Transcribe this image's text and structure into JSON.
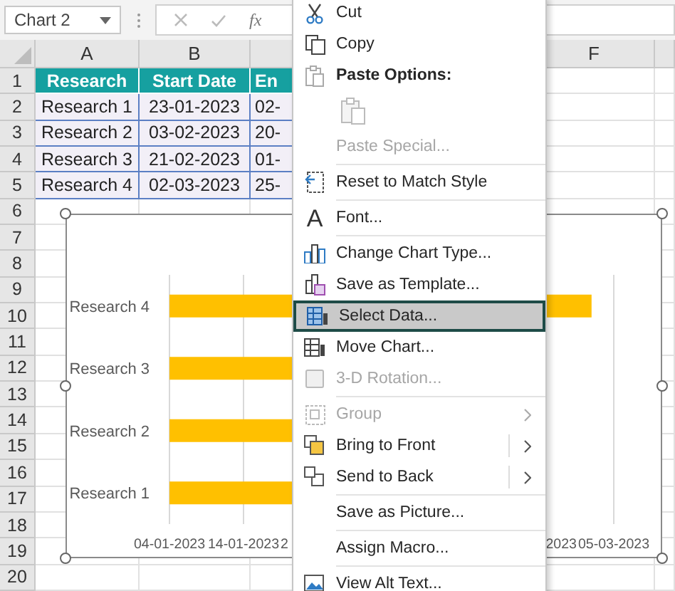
{
  "name_box": {
    "value": "Chart 2"
  },
  "formula_bar": {
    "function_label": "fx"
  },
  "sheet": {
    "columns": [
      {
        "header": "A"
      },
      {
        "header": "B"
      },
      {},
      {},
      {},
      {
        "header": "F"
      },
      {}
    ],
    "rows": [
      {
        "number": "1",
        "kind": "header",
        "cells": [
          "Research",
          "Start Date",
          "En"
        ]
      },
      {
        "number": "2",
        "kind": "data",
        "cells": [
          "Research 1",
          "23-01-2023",
          "02-"
        ]
      },
      {
        "number": "3",
        "kind": "data",
        "cells": [
          "Research 2",
          "03-02-2023",
          "20-"
        ]
      },
      {
        "number": "4",
        "kind": "data",
        "cells": [
          "Research 3",
          "21-02-2023",
          "01-"
        ]
      },
      {
        "number": "5",
        "kind": "data",
        "cells": [
          "Research 4",
          "02-03-2023",
          "25-"
        ]
      },
      {
        "number": "6"
      },
      {
        "number": "7"
      },
      {
        "number": "8"
      },
      {
        "number": "9"
      },
      {
        "number": "10"
      },
      {
        "number": "11"
      },
      {
        "number": "12"
      },
      {
        "number": "13"
      },
      {
        "number": "14"
      },
      {
        "number": "15"
      },
      {
        "number": "16"
      },
      {
        "number": "17"
      },
      {
        "number": "18"
      },
      {
        "number": "19"
      },
      {
        "number": "20"
      }
    ]
  },
  "chart": {
    "category_labels": [
      "Research 4",
      "Research 3",
      "Research 2",
      "Research 1"
    ],
    "x_axis_labels": [
      "04-01-2023",
      "14-01-2023",
      "2",
      "2023",
      "05-03-2023"
    ]
  },
  "context_menu": {
    "sections": [
      [
        {
          "kind": "item",
          "label": "Cut",
          "disabled": false,
          "selected": false,
          "submenu": false
        },
        {
          "kind": "item",
          "label": "Copy",
          "disabled": false,
          "selected": false,
          "submenu": false
        },
        {
          "kind": "header",
          "label": "Paste Options:"
        },
        {
          "kind": "paste-icons"
        },
        {
          "kind": "item",
          "label": "Paste Special...",
          "disabled": true,
          "selected": false,
          "submenu": false
        }
      ],
      [
        {
          "kind": "item",
          "label": "Reset to Match Style",
          "disabled": false,
          "selected": false,
          "submenu": false
        }
      ],
      [
        {
          "kind": "item",
          "label": "Font...",
          "glyph": "A",
          "disabled": false,
          "selected": false,
          "submenu": false
        }
      ],
      [
        {
          "kind": "item",
          "label": "Change Chart Type...",
          "disabled": false,
          "selected": false,
          "submenu": false
        },
        {
          "kind": "item",
          "label": "Save as Template...",
          "disabled": false,
          "selected": false,
          "submenu": false
        },
        {
          "kind": "item",
          "label": "Select Data...",
          "disabled": false,
          "selected": true,
          "submenu": false
        },
        {
          "kind": "item",
          "label": "Move Chart...",
          "disabled": false,
          "selected": false,
          "submenu": false
        },
        {
          "kind": "item",
          "label": "3-D Rotation...",
          "disabled": true,
          "selected": false,
          "submenu": false
        }
      ],
      [
        {
          "kind": "item",
          "label": "Group",
          "disabled": true,
          "selected": false,
          "submenu": true
        },
        {
          "kind": "item",
          "label": "Bring to Front",
          "disabled": false,
          "selected": false,
          "submenu": true
        },
        {
          "kind": "item",
          "label": "Send to Back",
          "disabled": false,
          "selected": false,
          "submenu": true
        }
      ],
      [
        {
          "kind": "item",
          "label": "Save as Picture...",
          "disabled": false,
          "selected": false,
          "submenu": false
        }
      ],
      [
        {
          "kind": "item",
          "label": "Assign Macro...",
          "disabled": false,
          "selected": false,
          "submenu": false
        }
      ],
      [
        {
          "kind": "item",
          "label": "View Alt Text...",
          "disabled": false,
          "selected": false,
          "submenu": false
        }
      ]
    ]
  }
}
